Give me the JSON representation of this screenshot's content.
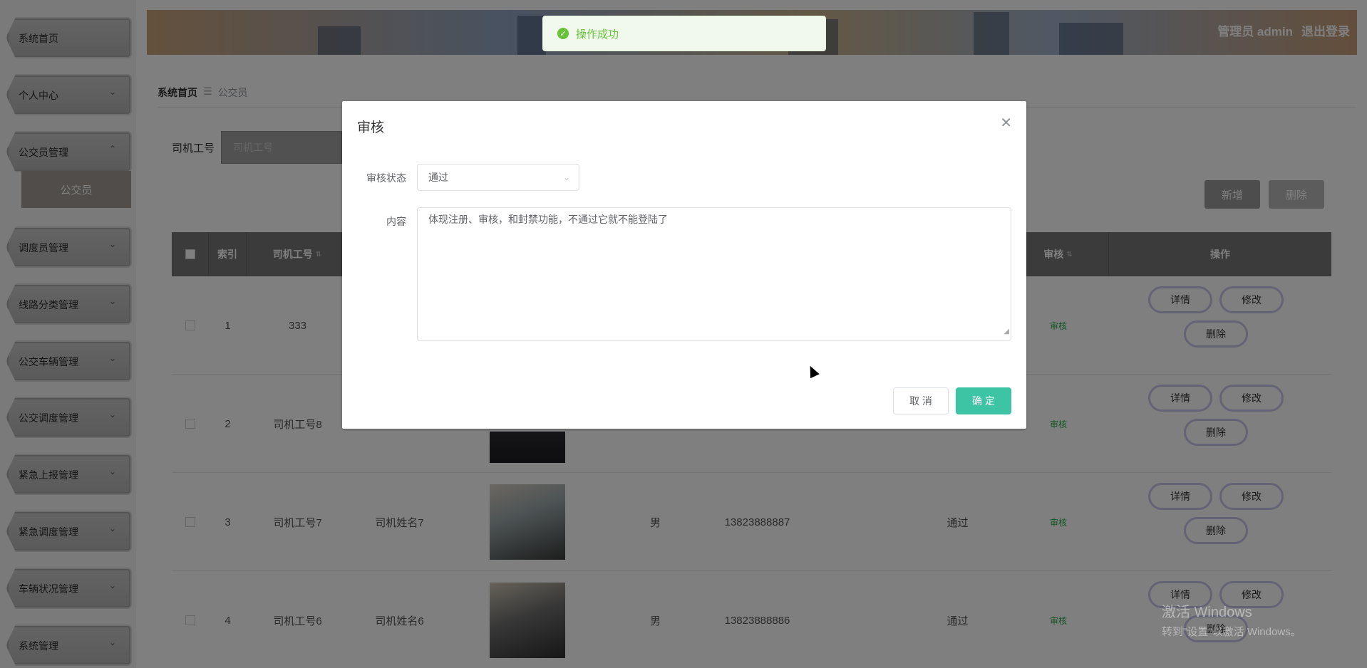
{
  "sidebar": {
    "items": [
      {
        "label": "系统首页",
        "chevron": ""
      },
      {
        "label": "个人中心",
        "chevron": "⌄"
      },
      {
        "label": "公交员管理",
        "chevron": "⌃"
      },
      {
        "label": "调度员管理",
        "chevron": "⌄"
      },
      {
        "label": "线路分类管理",
        "chevron": "⌄"
      },
      {
        "label": "公交车辆管理",
        "chevron": "⌄"
      },
      {
        "label": "公交调度管理",
        "chevron": "⌄"
      },
      {
        "label": "紧急上报管理",
        "chevron": "⌄"
      },
      {
        "label": "紧急调度管理",
        "chevron": "⌄"
      },
      {
        "label": "车辆状况管理",
        "chevron": "⌄"
      },
      {
        "label": "系统管理",
        "chevron": "⌄"
      }
    ],
    "submenu": "公交员"
  },
  "header": {
    "role": "管理员 admin",
    "logout": "退出登录"
  },
  "breadcrumb": {
    "home": "系统首页",
    "sep": "☰",
    "current": "公交员"
  },
  "search": {
    "label": "司机工号",
    "placeholder": "司机工号"
  },
  "actions": {
    "add": "新增",
    "delete": "删除"
  },
  "table": {
    "headers": [
      "索引",
      "司机工号",
      "审核",
      "操作"
    ],
    "rows": [
      {
        "index": "1",
        "driver_id": "333",
        "name": "",
        "gender": "",
        "phone": "",
        "status": "",
        "audit": "审核"
      },
      {
        "index": "2",
        "driver_id": "司机工号8",
        "name": "",
        "gender": "",
        "phone": "",
        "status": "",
        "audit": "审核"
      },
      {
        "index": "3",
        "driver_id": "司机工号7",
        "name": "司机姓名7",
        "gender": "男",
        "phone": "13823888887",
        "status": "通过",
        "audit": "审核"
      },
      {
        "index": "4",
        "driver_id": "司机工号6",
        "name": "司机姓名6",
        "gender": "男",
        "phone": "13823888886",
        "status": "通过",
        "audit": "审核"
      }
    ],
    "op_labels": {
      "detail": "详情",
      "edit": "修改",
      "remove": "删除"
    }
  },
  "toast": {
    "text": "操作成功"
  },
  "dialog": {
    "title": "审核",
    "status_label": "审核状态",
    "status_value": "通过",
    "content_label": "内容",
    "content_value": "体现注册、审核，和封禁功能，不通过它就不能登陆了",
    "cancel": "取 消",
    "confirm": "确 定"
  },
  "watermark": {
    "line1": "激活 Windows",
    "line2": "转到\"设置\"以激活 Windows。"
  }
}
